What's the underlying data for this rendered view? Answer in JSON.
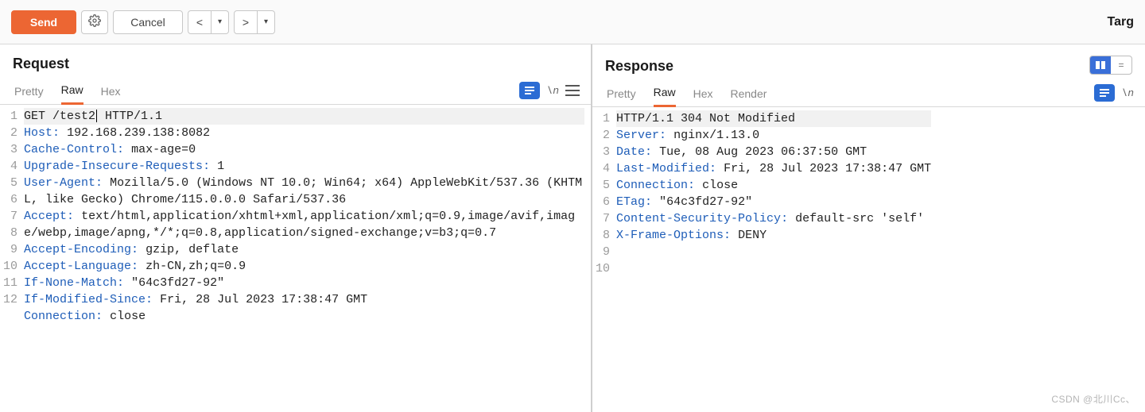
{
  "toolbar": {
    "send_label": "Send",
    "cancel_label": "Cancel",
    "prev_glyph": "<",
    "next_glyph": ">",
    "caret_glyph": "▾",
    "target_label": "Targ"
  },
  "panel_left_title": "Request",
  "panel_right_title": "Response",
  "tabs": {
    "pretty": "Pretty",
    "raw": "Raw",
    "hex": "Hex",
    "render": "Render"
  },
  "ctrls": {
    "ln_glyph": "\\n",
    "equals_glyph": "="
  },
  "request": {
    "lines": [
      {
        "n": 1,
        "kind": "start",
        "text": "GET /test2| HTTP/1.1"
      },
      {
        "n": 2,
        "kind": "hdr",
        "key": "Host",
        "val": "192.168.239.138:8082"
      },
      {
        "n": 3,
        "kind": "hdr",
        "key": "Cache-Control",
        "val": "max-age=0"
      },
      {
        "n": 4,
        "kind": "hdr",
        "key": "Upgrade-Insecure-Requests",
        "val": "1"
      },
      {
        "n": 5,
        "kind": "hdr",
        "key": "User-Agent",
        "val": "Mozilla/5.0 (Windows NT 10.0; Win64; x64) AppleWebKit/537.36 (KHTML, like Gecko) Chrome/115.0.0.0 Safari/537.36"
      },
      {
        "n": 6,
        "kind": "hdr",
        "key": "Accept",
        "val": "text/html,application/xhtml+xml,application/xml;q=0.9,image/avif,image/webp,image/apng,*/*;q=0.8,application/signed-exchange;v=b3;q=0.7"
      },
      {
        "n": 7,
        "kind": "hdr",
        "key": "Accept-Encoding",
        "val": "gzip, deflate"
      },
      {
        "n": 8,
        "kind": "hdr",
        "key": "Accept-Language",
        "val": "zh-CN,zh;q=0.9"
      },
      {
        "n": 9,
        "kind": "hdr",
        "key": "If-None-Match",
        "val": "\"64c3fd27-92\""
      },
      {
        "n": 10,
        "kind": "hdr",
        "key": "If-Modified-Since",
        "val": "Fri, 28 Jul 2023 17:38:47 GMT"
      },
      {
        "n": 11,
        "kind": "hdr",
        "key": "Connection",
        "val": "close"
      },
      {
        "n": 12,
        "kind": "blank"
      }
    ]
  },
  "response": {
    "lines": [
      {
        "n": 1,
        "kind": "start",
        "text": "HTTP/1.1 304 Not Modified"
      },
      {
        "n": 2,
        "kind": "hdr",
        "key": "Server",
        "val": "nginx/1.13.0"
      },
      {
        "n": 3,
        "kind": "hdr",
        "key": "Date",
        "val": "Tue, 08 Aug 2023 06:37:50 GMT"
      },
      {
        "n": 4,
        "kind": "hdr",
        "key": "Last-Modified",
        "val": "Fri, 28 Jul 2023 17:38:47 GMT"
      },
      {
        "n": 5,
        "kind": "hdr",
        "key": "Connection",
        "val": "close"
      },
      {
        "n": 6,
        "kind": "hdr",
        "key": "ETag",
        "val": "\"64c3fd27-92\""
      },
      {
        "n": 7,
        "kind": "hdr",
        "key": "Content-Security-Policy",
        "val": "default-src 'self'"
      },
      {
        "n": 8,
        "kind": "hdr",
        "key": "X-Frame-Options",
        "val": "DENY"
      },
      {
        "n": 9,
        "kind": "blank"
      },
      {
        "n": 10,
        "kind": "blank"
      }
    ]
  },
  "watermark": "CSDN @北川Cc、"
}
